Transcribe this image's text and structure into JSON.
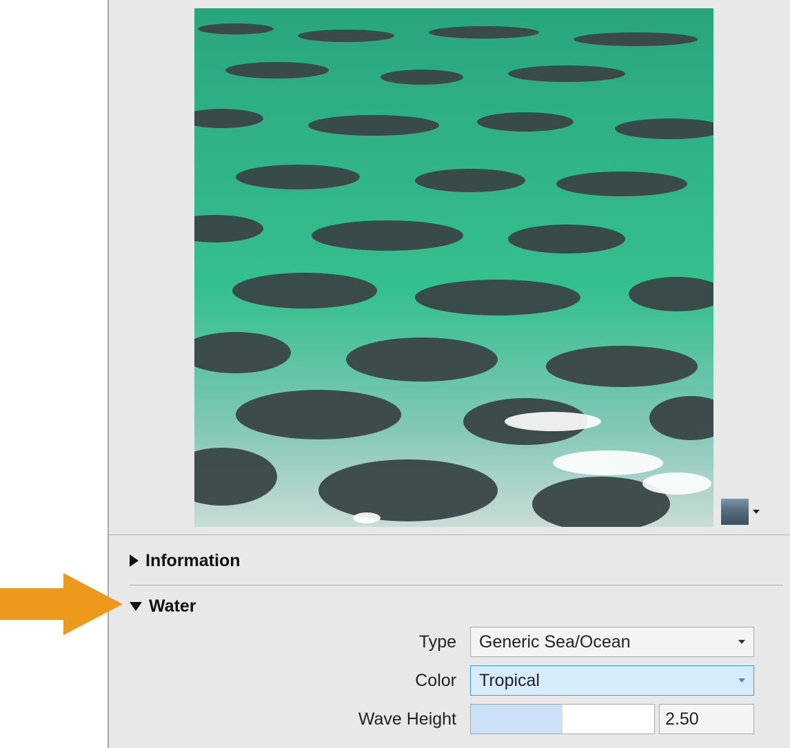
{
  "preview": {
    "swatch_icon": "ocean-thumbnail-icon",
    "dropdown_icon": "chevron-down-icon"
  },
  "sections": {
    "information": {
      "title": "Information",
      "expanded": false
    },
    "water": {
      "title": "Water",
      "expanded": true
    }
  },
  "water": {
    "type": {
      "label": "Type",
      "value": "Generic Sea/Ocean"
    },
    "color": {
      "label": "Color",
      "value": "Tropical"
    },
    "wave_height": {
      "label": "Wave Height",
      "value": "2.50",
      "slider_fraction": 0.5
    }
  },
  "annotation": {
    "arrow_color": "#ed9a1c"
  },
  "colors": {
    "panel_bg": "#e8e8e8",
    "water_dark": "#3a4646",
    "water_green": "#34c08e",
    "focus_bg": "#d6ecfa",
    "slider_fill": "#c9e0f7"
  }
}
